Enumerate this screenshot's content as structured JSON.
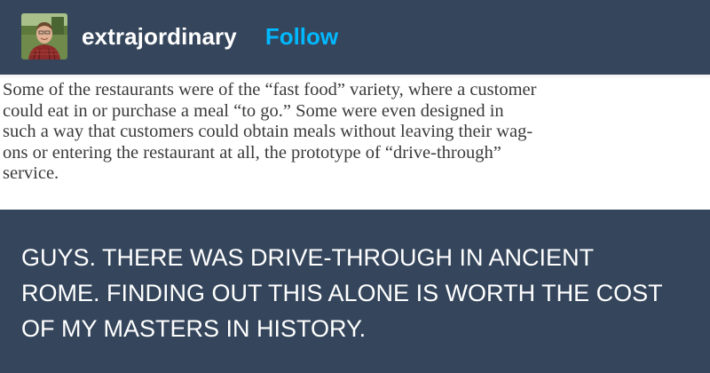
{
  "post": {
    "author": {
      "username": "extrajordinary",
      "avatar_icon": "person-avatar-icon"
    },
    "follow_label": "Follow",
    "excerpt_text": "Some of the restaurants were of the “fast food” variety, where a customer\ncould eat in or purchase a meal “to go.” Some were even designed in\nsuch a way that customers could obtain meals without leaving their wag-\nons or entering the restaurant at all, the prototype of “drive-through”\nservice.",
    "caption": "GUYS. THERE WAS DRIVE-THROUGH IN ANCIENT\nROME. FINDING OUT THIS ALONE IS WORTH THE COST\nOF MY MASTERS IN HISTORY."
  },
  "colors": {
    "background": "#35465c",
    "follow_accent": "#00b8ff",
    "text_primary": "#ffffff"
  }
}
